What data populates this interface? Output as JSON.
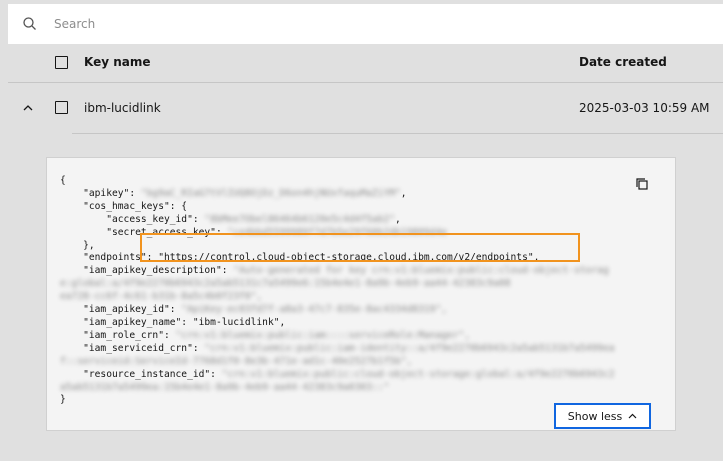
{
  "search": {
    "placeholder": "Search"
  },
  "table": {
    "headers": {
      "key_name": "Key name",
      "date_created": "Date created"
    },
    "rows": [
      {
        "key_name": "ibm-lucidlink",
        "date_created": "2025-03-03 10:59 AM"
      }
    ]
  },
  "json_view": {
    "open_brace": "{",
    "apikey_label": "\"apikey\": ",
    "apikey_value": "\"bg9aC_RIaG7tVlIUQ8OjDz_D6on4hjNUxfaquMaZiYM\"",
    "cos_label": "\"cos_hmac_keys\": {",
    "access_key_label": "\"access_key_id\": ",
    "access_key_value": "\"8bMee7Obel86464b6120e5c4d4f5ab2\"",
    "secret_key_label": "\"secret_access_key\": ",
    "secret_key_value": "\"ce4bbd5599989f7d7b5e29f60b2db19809d4e",
    "close_inner": "},",
    "endpoints_line": "\"endpoints\": \"https://control.cloud-object-storage.cloud.ibm.com/v2/endpoints\",",
    "desc_label": "\"iam_apikey_description\": ",
    "desc_value_1": "\"Auto-generated for key crn:v1:bluemix:public:cloud-object-storag",
    "desc_value_2": "e:global:a/4f9e2270b6943c2a5ab5131c7a5499e6:15b4e4e1-8a9b-4eb9-aa44-42383c9a08",
    "desc_value_3": "ea728-cc6f-4c61-b31b-8a5c4b0f23f0\",",
    "apikey_id_label": "\"iam_apikey_id\": ",
    "apikey_id_value": "\"ApiKey-ec03fd7f-a8a3-47c7-835e-8ac4334d8319\",",
    "apikey_name_line": "\"iam_apikey_name\": \"ibm-lucidlink\",",
    "role_label": "\"iam_role_crn\": ",
    "role_value": "\"crn:v1:bluemix:public:iam::::serviceRole:Manager\",",
    "sid_label": "\"iam_serviceid_crn\": ",
    "sid_value_1": "\"crn:v1:bluemix:public:iam-identity::a/4f9e2270b6943c2a5ab5131b7a5499ea",
    "sid_value_2": "f::serviceid:ServiceId-7768d1f0-8e3b-471e-ad1c-40e2527b1f5b\",",
    "rid_label": "\"resource_instance_id\": ",
    "rid_value_1": "\"crn:v1:bluemix:public:cloud-object-storage:global:a/4f9e2270b6943c2",
    "rid_value_2": "a5ab5131b7a5499ea:15b4e4e1-8a9b-4eb9-aa44-42383c9a0303::\"",
    "close_brace": "}"
  },
  "show_less": {
    "label": "Show less"
  },
  "colors": {
    "highlight": "#f1931e",
    "focus_blue": "#1066e0",
    "background": "#e0e0e0"
  },
  "icons": {
    "search": "search-icon",
    "chevron_up": "chevron-up-icon",
    "copy": "copy-icon"
  }
}
